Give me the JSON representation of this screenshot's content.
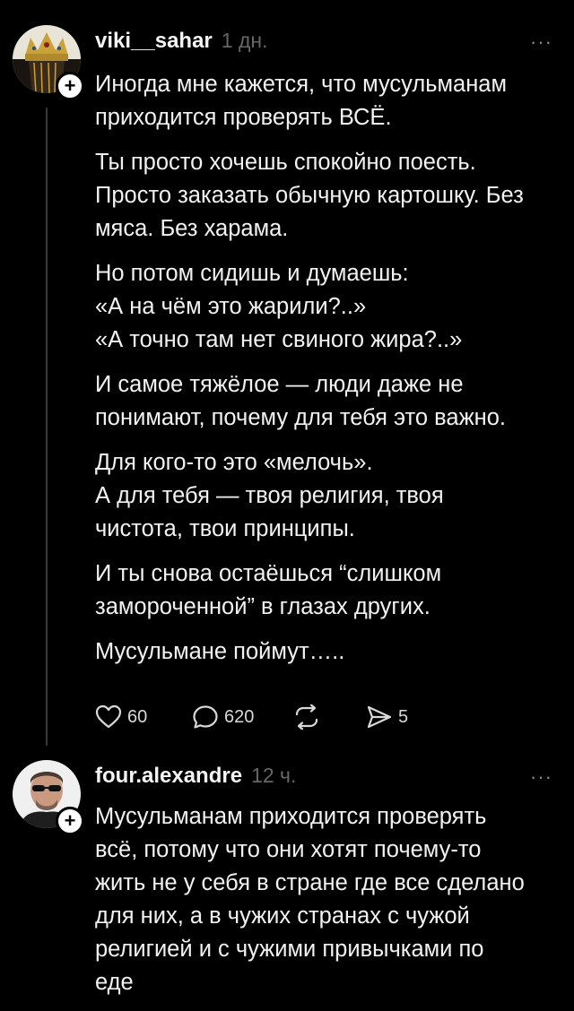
{
  "posts": [
    {
      "username": "viki__sahar",
      "time": "1 дн.",
      "more": "···",
      "follow_symbol": "+",
      "avatar": "crown-avatar",
      "paragraphs": [
        "Иногда мне кажется, что мусульманам\nприходится проверять ВСЁ.",
        "Ты просто хочешь спокойно поесть.\nПросто заказать обычную картошку. Без\nмяса. Без харама.",
        "Но потом сидишь и думаешь:\n«А на чём это жарили?..»\n«А точно там нет свиного жира?..»",
        "И самое тяжёлое — люди даже не\nпонимают, почему для тебя это важно.",
        "Для кого-то это «мелочь».\nА для тебя — твоя религия, твоя\nчистота, твои принципы.",
        "И ты снова остаёшься “слишком\nзамороченной” в глазах других.",
        "Мусульмане поймут….."
      ],
      "actions": {
        "likes": "60",
        "comments": "620",
        "reposts": "",
        "shares": "5"
      }
    },
    {
      "username": "four.alexandre",
      "time": "12 ч.",
      "more": "···",
      "follow_symbol": "+",
      "avatar": "man-sunglasses-avatar",
      "paragraphs": [
        "Мусульманам приходится проверять\nвсё, потому что они хотят почему-то\nжить не у себя в стране где все сделано\nдля них, а в чужих странах с чужой\nрелигией и с чужими привычками по\nеде"
      ]
    }
  ],
  "colors": {
    "background": "#000000",
    "text": "#f2f2f2",
    "muted": "#666666",
    "thread_line": "#3a3a3a"
  }
}
